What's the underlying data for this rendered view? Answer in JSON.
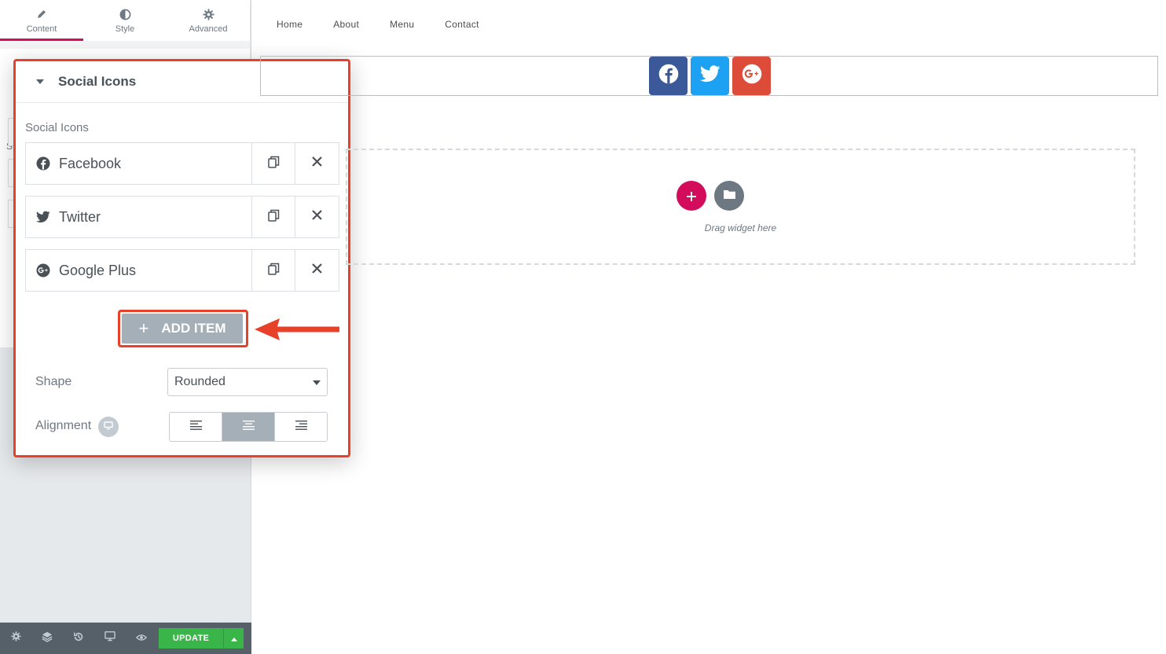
{
  "panel": {
    "tabs": [
      {
        "label": "Content",
        "icon": "pencil-icon"
      },
      {
        "label": "Style",
        "icon": "half-circle-icon"
      },
      {
        "label": "Advanced",
        "icon": "gear-icon"
      }
    ],
    "ghost_letter": "S",
    "footer": {
      "update_label": "UPDATE",
      "icons": [
        "settings-icon",
        "layers-icon",
        "history-icon",
        "responsive-icon",
        "preview-icon"
      ]
    }
  },
  "section": {
    "title": "Social Icons",
    "repeater_label": "Social Icons",
    "items": [
      {
        "label": "Facebook",
        "icon": "facebook-icon"
      },
      {
        "label": "Twitter",
        "icon": "twitter-icon"
      },
      {
        "label": "Google Plus",
        "icon": "google-plus-icon"
      }
    ],
    "add_item_label": "ADD ITEM",
    "shape_label": "Shape",
    "shape_value": "Rounded",
    "alignment_label": "Alignment",
    "alignment_options": [
      "left",
      "center",
      "right"
    ],
    "alignment_selected": "center"
  },
  "preview": {
    "nav": [
      "Home",
      "About",
      "Menu",
      "Contact"
    ],
    "social_icons": [
      {
        "name": "facebook",
        "color": "#3b5998"
      },
      {
        "name": "twitter",
        "color": "#1da1f2"
      },
      {
        "name": "google-plus",
        "color": "#dd4b39"
      }
    ],
    "drop_hint": "Drag widget here"
  },
  "colors": {
    "accent": "#d30c5c",
    "highlight": "#e8412a",
    "update_green": "#39b54a"
  }
}
